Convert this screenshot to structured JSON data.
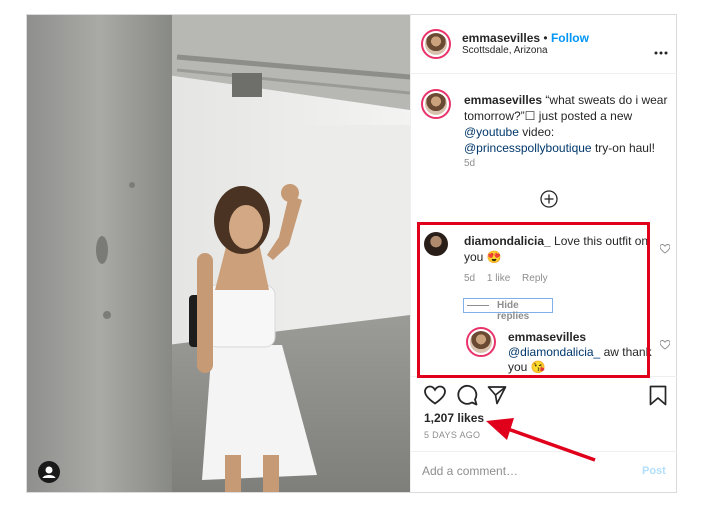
{
  "header": {
    "username": "emmasevilles",
    "separator": "•",
    "follow_label": "Follow",
    "location": "Scottsdale, Arizona",
    "more_icon": "ellipsis-icon"
  },
  "caption": {
    "username": "emmasevilles",
    "text": "“what sweats do i wear tomorrow?”☐ just posted a new",
    "mention1": "@youtube",
    "text2": "video:",
    "mention2": "@princesspollyboutique",
    "text3": "try-on haul!",
    "age": "5d"
  },
  "load_more_icon": "plus-circle-icon",
  "comment": {
    "username": "diamondalicia_",
    "text": "Love this outfit on you 😍",
    "age": "5d",
    "likes": "1 like",
    "reply_label": "Reply",
    "hide_replies_label": "Hide replies"
  },
  "reply": {
    "username": "emmasevilles",
    "mention": "@diamondalicia_",
    "text": "aw thank you 😘"
  },
  "actions": {
    "likes": "1,207 likes",
    "time": "5 DAYS AGO"
  },
  "add_comment": {
    "placeholder": "Add a comment…",
    "post_label": "Post"
  },
  "colors": {
    "accent_blue": "#0095f6",
    "annotation_red": "#e0001b"
  }
}
